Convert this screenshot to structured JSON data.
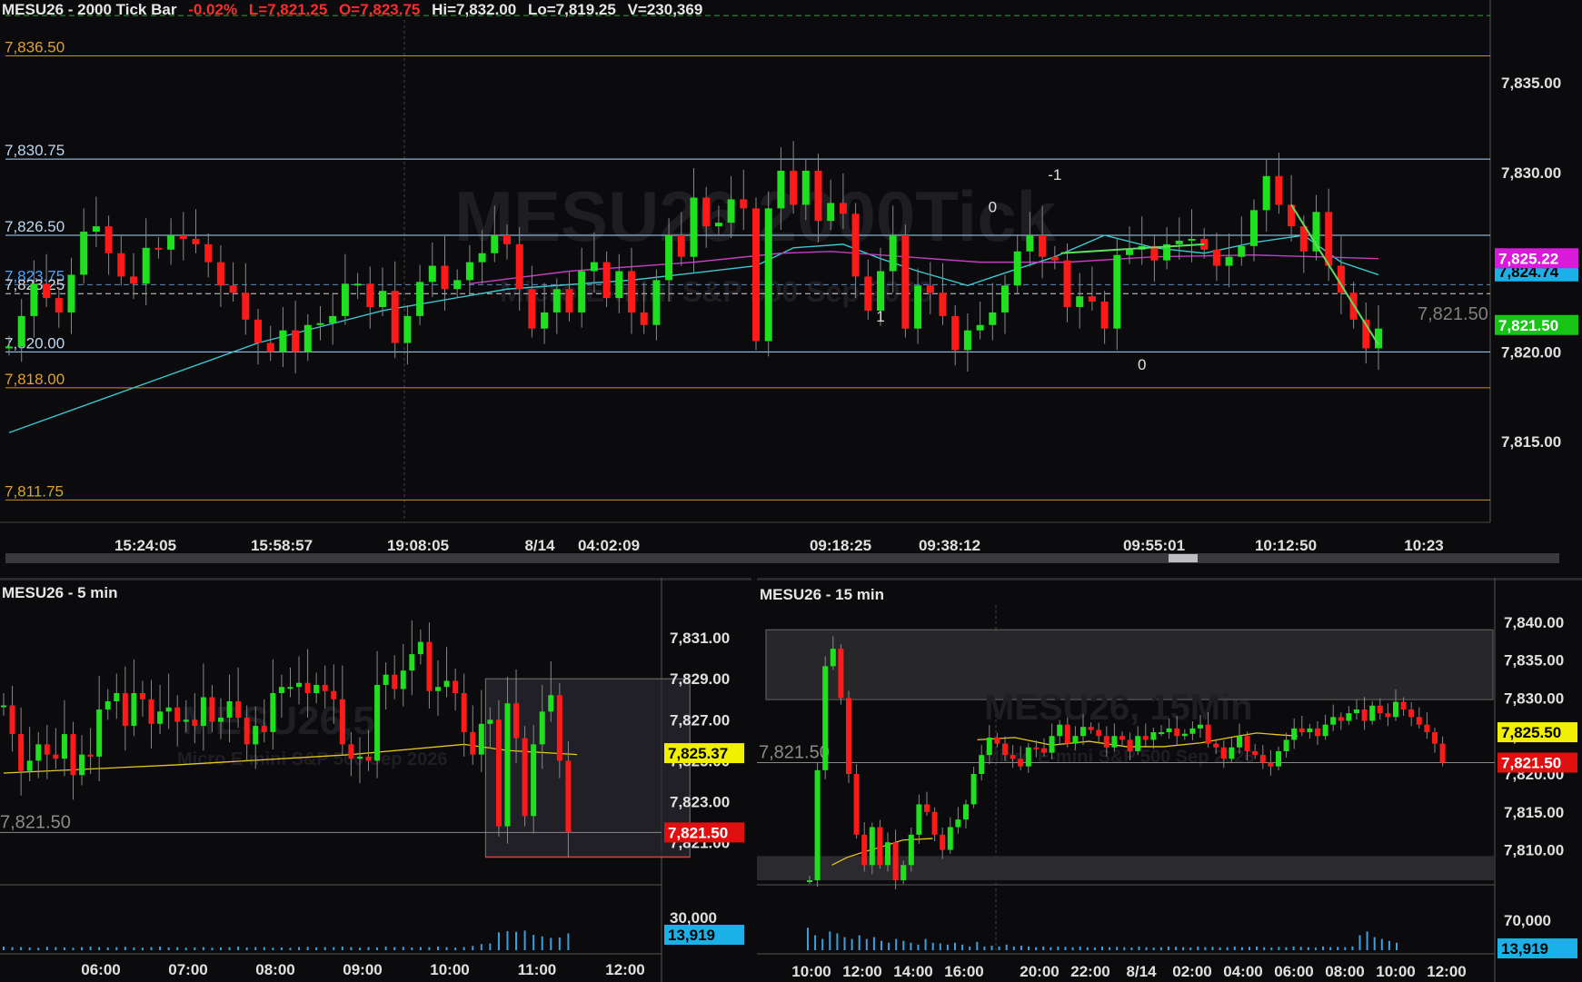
{
  "colors": {
    "background": "#0b0b0d",
    "up": "#1fe01f",
    "down": "#ff1a1a",
    "gold_line": "#c8921e",
    "blue_line": "#a8d8ff",
    "ma_cyan": "#3cc8d2",
    "ma_magenta": "#c040c0",
    "ma_yellow": "#e6c81e",
    "volume": "#3aa0e0",
    "label_green": "#16c416",
    "label_red": "#e01010",
    "label_yellow": "#f0f000",
    "label_magenta": "#d81bd8",
    "label_cyan": "#1ab0e8"
  },
  "main_header": {
    "symbol": "MESU26 - 2000 Tick Bar",
    "change": "-0.02%",
    "last": "L=7,821.25",
    "open": "O=7,823.75",
    "hi": "Hi=7,832.00",
    "lo": "Lo=7,819.25",
    "volume": "V=230,369"
  },
  "bl_header": {
    "symbol": "MESU26 - 5 min"
  },
  "br_header": {
    "symbol": "MESU26 - 15 min"
  },
  "chart_data": [
    {
      "type": "candlestick",
      "title": "MESU26 - 2000 Tick Bar",
      "watermark": "MESU26 2000Tick",
      "watermark_sub": "Micro E-mini S&P 500 Sep 2026",
      "y_ticks": [
        "7,835.00",
        "7,830.00",
        "7,825.00",
        "7,820.00",
        "7,815.00"
      ],
      "ylim": [
        7810.5,
        7838.5
      ],
      "x_ticks": [
        "15:24:05",
        "15:58:57",
        "19:08:05",
        "8/14",
        "04:02:09",
        "09:18:25",
        "09:38:12",
        "09:55:01",
        "10:12:50",
        "10:23"
      ],
      "levels": [
        {
          "label": "7,836.50",
          "value": 7836.5,
          "kind": "gold"
        },
        {
          "label": "7,830.75",
          "value": 7830.75,
          "kind": "blue"
        },
        {
          "label": "7,826.50",
          "value": 7826.5,
          "kind": "blue"
        },
        {
          "label": "7,823.75",
          "value": 7823.75,
          "kind": "dashblue"
        },
        {
          "label": "7,823.25",
          "value": 7823.25,
          "kind": "dashwhite"
        },
        {
          "label": "7,820.00",
          "value": 7820.0,
          "kind": "blue"
        },
        {
          "label": "7,818.00",
          "value": 7818.0,
          "kind": "gold"
        },
        {
          "label": "7,811.75",
          "value": 7811.75,
          "kind": "gold"
        }
      ],
      "top_dashed_level": 7838.75,
      "last_value_text": "7,821.50",
      "price_labels": [
        {
          "text": "7,825.22",
          "value": 7825.22,
          "color": "magenta"
        },
        {
          "text": "7,824.74",
          "value": 7824.74,
          "color": "cyan"
        },
        {
          "text": "7,821.50",
          "value": 7821.5,
          "color": "green"
        }
      ],
      "annotations": [
        {
          "text": "1",
          "x": 70,
          "value": 7821.7
        },
        {
          "text": "0",
          "x": 79,
          "value": 7827.8
        },
        {
          "text": "-1",
          "x": 84,
          "value": 7829.6
        },
        {
          "text": "0",
          "x": 91,
          "value": 7819.0
        }
      ],
      "closes": [
        7820.3,
        7822.0,
        7823.8,
        7823.0,
        7822.2,
        7824.3,
        7826.7,
        7827.0,
        7825.5,
        7824.2,
        7823.8,
        7825.8,
        7825.7,
        7826.5,
        7826.3,
        7826.0,
        7825.0,
        7823.7,
        7823.3,
        7821.8,
        7820.5,
        7820.0,
        7821.2,
        7820.0,
        7821.5,
        7821.6,
        7822.0,
        7823.8,
        7823.8,
        7822.5,
        7823.4,
        7820.5,
        7822.0,
        7823.9,
        7824.8,
        7823.5,
        7824.0,
        7825.0,
        7825.5,
        7826.5,
        7826.0,
        7823.5,
        7821.3,
        7822.2,
        7823.5,
        7822.2,
        7824.5,
        7825.0,
        7823.0,
        7824.5,
        7822.2,
        7821.5,
        7824.0,
        7826.5,
        7825.3,
        7828.6,
        7827.0,
        7827.2,
        7828.5,
        7828.0,
        7820.6,
        7828.0,
        7830.1,
        7828.2,
        7830.1,
        7827.3,
        7828.3,
        7827.7,
        7824.2,
        7822.3,
        7824.5,
        7826.5,
        7821.3,
        7823.7,
        7823.3,
        7822.0,
        7820.1,
        7821.2,
        7821.5,
        7822.2,
        7823.7,
        7825.6,
        7826.5,
        7825.3,
        7825.1,
        7822.5,
        7823.1,
        7822.8,
        7821.3,
        7825.4,
        7825.7,
        7825.9,
        7825.1,
        7826.0,
        7826.2,
        7826.3,
        7825.7,
        7824.8,
        7825.3,
        7825.9,
        7827.9,
        7829.8,
        7828.2,
        7827.0,
        7825.6,
        7827.8,
        7824.8,
        7823.3,
        7821.8,
        7820.2,
        7821.3
      ],
      "ma_cyan": [
        [
          0,
          7815.5
        ],
        [
          10,
          7818.0
        ],
        [
          20,
          7820.5
        ],
        [
          30,
          7822.3
        ],
        [
          40,
          7823.5
        ],
        [
          50,
          7824.0
        ],
        [
          60,
          7824.8
        ],
        [
          63,
          7825.8
        ],
        [
          67,
          7826.0
        ],
        [
          70,
          7825.2
        ],
        [
          73,
          7824.5
        ],
        [
          77,
          7823.7
        ],
        [
          80,
          7824.4
        ],
        [
          84,
          7825.3
        ],
        [
          88,
          7826.5
        ],
        [
          92,
          7825.8
        ],
        [
          96,
          7825.5
        ],
        [
          100,
          7826.1
        ],
        [
          104,
          7826.5
        ],
        [
          107,
          7825.0
        ],
        [
          110,
          7824.3
        ]
      ],
      "ma_magenta": [
        [
          37,
          7823.8
        ],
        [
          45,
          7824.5
        ],
        [
          55,
          7825.0
        ],
        [
          62,
          7825.5
        ],
        [
          66,
          7825.6
        ],
        [
          72,
          7825.3
        ],
        [
          78,
          7825.0
        ],
        [
          85,
          7825.0
        ],
        [
          92,
          7825.3
        ],
        [
          100,
          7825.4
        ],
        [
          110,
          7825.2
        ]
      ],
      "trend_segments": [
        [
          [
            84.5,
            7825.5
          ],
          [
            96,
            7826.0
          ]
        ],
        [
          [
            103,
            7828.2
          ],
          [
            110,
            7820.4
          ]
        ]
      ]
    },
    {
      "type": "candlestick",
      "title": "MESU26 - 5 min",
      "watermark": "MESU26,5",
      "watermark_sub": "Micro E-mini S&P 500 Sep 2026",
      "y_ticks": [
        "7,831.00",
        "7,829.00",
        "7,827.00",
        "7,825.00",
        "7,823.00",
        "7,821.00"
      ],
      "ylim": [
        7819.3,
        7832.6
      ],
      "volume_tick": "30,000",
      "x_ticks": [
        "06:00",
        "07:00",
        "08:00",
        "09:00",
        "10:00",
        "11:00",
        "12:00"
      ],
      "last_value_text": "7,821.50",
      "zone": {
        "x_from": 56,
        "x_to": 79,
        "y_from": 7820.3,
        "y_to": 7829.0
      },
      "price_labels": [
        {
          "text": "7,825.37",
          "value": 7825.37,
          "color": "yellow"
        },
        {
          "text": "7,821.50",
          "value": 7821.5,
          "color": "red"
        }
      ],
      "volume_label": "13,919",
      "closes": [
        7827.7,
        7826.3,
        7824.5,
        7825.0,
        7825.8,
        7825.3,
        7825.1,
        7826.3,
        7824.3,
        7825.3,
        7825.2,
        7827.5,
        7827.9,
        7828.3,
        7826.7,
        7828.3,
        7828.0,
        7826.8,
        7827.4,
        7827.6,
        7826.9,
        7827.0,
        7826.7,
        7828.1,
        7826.9,
        7827.1,
        7827.9,
        7827.1,
        7825.8,
        7826.7,
        7826.4,
        7828.3,
        7828.6,
        7828.6,
        7828.8,
        7828.3,
        7828.7,
        7828.4,
        7828.0,
        7825.8,
        7825.1,
        7825.2,
        7825.0,
        7828.7,
        7829.2,
        7828.5,
        7829.4,
        7830.2,
        7830.8,
        7828.4,
        7828.6,
        7828.9,
        7828.3,
        7826.4,
        7825.3,
        7826.8,
        7827.0,
        7821.8,
        7827.8,
        7826.1,
        7822.3,
        7825.8,
        7827.4,
        7828.2,
        7825.0,
        7821.5
      ],
      "ma": [
        [
          0,
          7824.4
        ],
        [
          20,
          7824.8
        ],
        [
          40,
          7825.3
        ],
        [
          53,
          7825.8
        ],
        [
          58,
          7825.5
        ],
        [
          66,
          7825.3
        ]
      ],
      "volumes": [
        0.12,
        0.1,
        0.1,
        0.09,
        0.08,
        0.11,
        0.1,
        0.09,
        0.08,
        0.1,
        0.12,
        0.1,
        0.09,
        0.1,
        0.11,
        0.09,
        0.08,
        0.1,
        0.12,
        0.09,
        0.1,
        0.08,
        0.09,
        0.1,
        0.08,
        0.09,
        0.1,
        0.12,
        0.09,
        0.1,
        0.1,
        0.08,
        0.09,
        0.08,
        0.1,
        0.11,
        0.09,
        0.1,
        0.1,
        0.12,
        0.1,
        0.08,
        0.1,
        0.09,
        0.12,
        0.1,
        0.11,
        0.09,
        0.1,
        0.1,
        0.12,
        0.1,
        0.08,
        0.1,
        0.14,
        0.2,
        0.22,
        0.58,
        0.62,
        0.6,
        0.64,
        0.5,
        0.45,
        0.4,
        0.42,
        0.55
      ]
    },
    {
      "type": "candlestick",
      "title": "MESU26 - 15 min",
      "watermark": "MESU26, 15Min",
      "watermark_sub": "Micro E-mini S&P 500 Sep 2026",
      "y_ticks": [
        "7,840.00",
        "7,835.00",
        "7,830.00",
        "7,825.00",
        "7,820.00",
        "7,815.00",
        "7,810.00"
      ],
      "ylim": [
        7806.0,
        7842.5
      ],
      "volume_tick": "70,000",
      "x_ticks": [
        "10:00",
        "12:00",
        "14:00",
        "16:00",
        "20:00",
        "22:00",
        "8/14",
        "02:00",
        "04:00",
        "06:00",
        "08:00",
        "10:00",
        "12:00"
      ],
      "last_value_text": "7,821.50",
      "zones": [
        {
          "y_from": 7829.8,
          "y_to": 7839.0
        },
        {
          "y_from": 7806.0,
          "y_to": 7809.2
        }
      ],
      "price_labels": [
        {
          "text": "7,825.50",
          "value": 7825.5,
          "color": "yellow"
        },
        {
          "text": "7,821.50",
          "value": 7821.5,
          "color": "red"
        }
      ],
      "volume_label": "13,919",
      "closes": [
        7806.0,
        7820.5,
        7834.2,
        7836.5,
        7830.0,
        7820.0,
        7812.0,
        7808.0,
        7813.0,
        7808.0,
        7811.0,
        7806.0,
        7808.0,
        7812.0,
        7816.0,
        7815.0,
        7812.0,
        7810.0,
        7813.0,
        7814.0,
        7816.0,
        7820.0,
        7822.5,
        7824.8,
        7824.0,
        7822.5,
        7822.0,
        7821.0,
        7823.5,
        7823.4,
        7822.8,
        7825.0,
        7826.5,
        7824.0,
        7825.0,
        7826.2,
        7825.8,
        7825.0,
        7823.5,
        7825.0,
        7824.5,
        7823.0,
        7825.0,
        7824.5,
        7825.5,
        7825.5,
        7826.0,
        7825.0,
        7825.3,
        7826.0,
        7826.5,
        7824.0,
        7823.5,
        7822.0,
        7823.5,
        7825.0,
        7823.0,
        7822.5,
        7821.5,
        7821.0,
        7823.0,
        7824.5,
        7826.0,
        7825.5,
        7826.0,
        7825.0,
        7826.5,
        7827.5,
        7827.0,
        7828.0,
        7828.5,
        7827.0,
        7829.0,
        7828.0,
        7827.5,
        7829.5,
        7828.5,
        7827.5,
        7826.5,
        7825.5,
        7824.0,
        7821.5
      ],
      "ma": [
        [
          6,
          7808.0
        ],
        [
          10,
          7809.0
        ],
        [
          15,
          7809.8
        ],
        [
          20,
          7810.5
        ],
        [
          25,
          7811.3
        ],
        [
          33,
          7811.5
        ]
      ],
      "ma2": [
        [
          45,
          7824.5
        ],
        [
          55,
          7824.8
        ],
        [
          65,
          7823.8
        ],
        [
          75,
          7824.3
        ],
        [
          85,
          7823.6
        ],
        [
          95,
          7823.6
        ],
        [
          105,
          7824.1
        ],
        [
          115,
          7825.0
        ],
        [
          120,
          7825.4
        ],
        [
          125,
          7825.2
        ],
        [
          131,
          7825.0
        ]
      ],
      "volumes": [
        0.6,
        0.4,
        0.3,
        0.5,
        0.45,
        0.35,
        0.3,
        0.4,
        0.3,
        0.35,
        0.25,
        0.2,
        0.3,
        0.25,
        0.2,
        0.15,
        0.3,
        0.2,
        0.18,
        0.15,
        0.2,
        0.15,
        0.1,
        0.22,
        0.1,
        0.12,
        0.1,
        0.15,
        0.1,
        0.12,
        0.1,
        0.08,
        0.1,
        0.08,
        0.1,
        0.09,
        0.08,
        0.1,
        0.08,
        0.07,
        0.1,
        0.08,
        0.09,
        0.08,
        0.07,
        0.1,
        0.08,
        0.07,
        0.08,
        0.1,
        0.09,
        0.08,
        0.07,
        0.1,
        0.08,
        0.09,
        0.07,
        0.08,
        0.1,
        0.08,
        0.09,
        0.1,
        0.08,
        0.07,
        0.09,
        0.08,
        0.1,
        0.09,
        0.08,
        0.07,
        0.1,
        0.08,
        0.09,
        0.08,
        0.1,
        0.4,
        0.5,
        0.35,
        0.3,
        0.25,
        0.2
      ]
    }
  ]
}
